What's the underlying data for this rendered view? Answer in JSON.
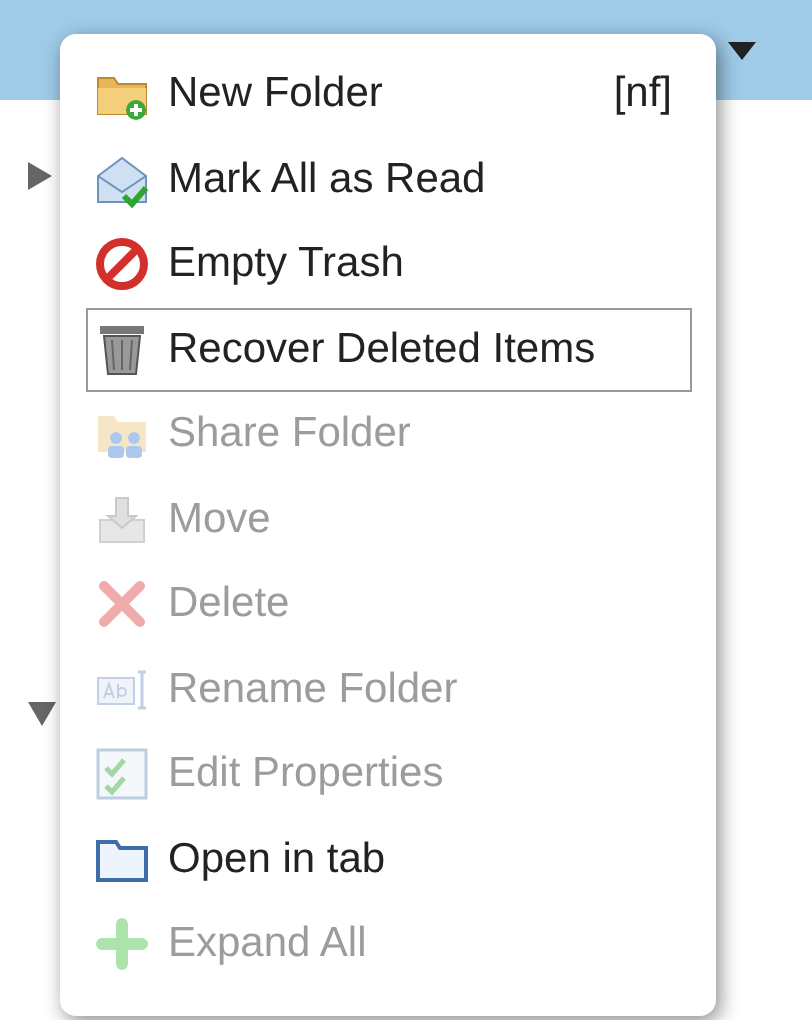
{
  "menu": {
    "items": [
      {
        "kind": "new-folder",
        "label": "New Folder",
        "shortcut": "[nf]",
        "disabled": false,
        "selected": false
      },
      {
        "kind": "mark-read",
        "label": "Mark All as Read",
        "disabled": false,
        "selected": false
      },
      {
        "kind": "empty-trash",
        "label": "Empty Trash",
        "disabled": false,
        "selected": false
      },
      {
        "kind": "recover",
        "label": "Recover Deleted Items",
        "disabled": false,
        "selected": true
      },
      {
        "kind": "share",
        "label": "Share Folder",
        "disabled": true,
        "selected": false
      },
      {
        "kind": "move",
        "label": "Move",
        "disabled": true,
        "selected": false
      },
      {
        "kind": "delete",
        "label": "Delete",
        "disabled": true,
        "selected": false
      },
      {
        "kind": "rename",
        "label": "Rename Folder",
        "disabled": true,
        "selected": false
      },
      {
        "kind": "properties",
        "label": "Edit Properties",
        "disabled": true,
        "selected": false
      },
      {
        "kind": "open-tab",
        "label": "Open in tab",
        "disabled": false,
        "selected": false
      },
      {
        "kind": "expand",
        "label": "Expand All",
        "disabled": true,
        "selected": false
      }
    ]
  }
}
